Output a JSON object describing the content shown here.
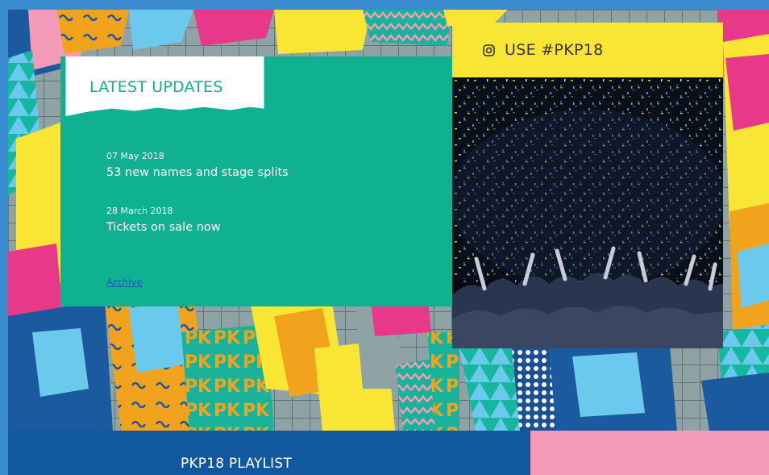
{
  "updates": {
    "title": "LATEST UPDATES",
    "items": [
      {
        "date": "07 May 2018",
        "title": "53 new names and stage splits"
      },
      {
        "date": "28 March 2018",
        "title": "Tickets on sale now"
      }
    ],
    "archive_label": "Archive"
  },
  "instagram": {
    "label": "USE #PKP18",
    "icon": "instagram-icon"
  },
  "playlist": {
    "title": "PKP18 PLAYLIST"
  },
  "colors": {
    "frame_blue": "#3b8bd0",
    "teal": "#0fb191",
    "yellow": "#f9e534",
    "navy": "#11589f",
    "pink": "#f59ab9",
    "orange": "#f2a31e",
    "magenta": "#e8388a"
  }
}
